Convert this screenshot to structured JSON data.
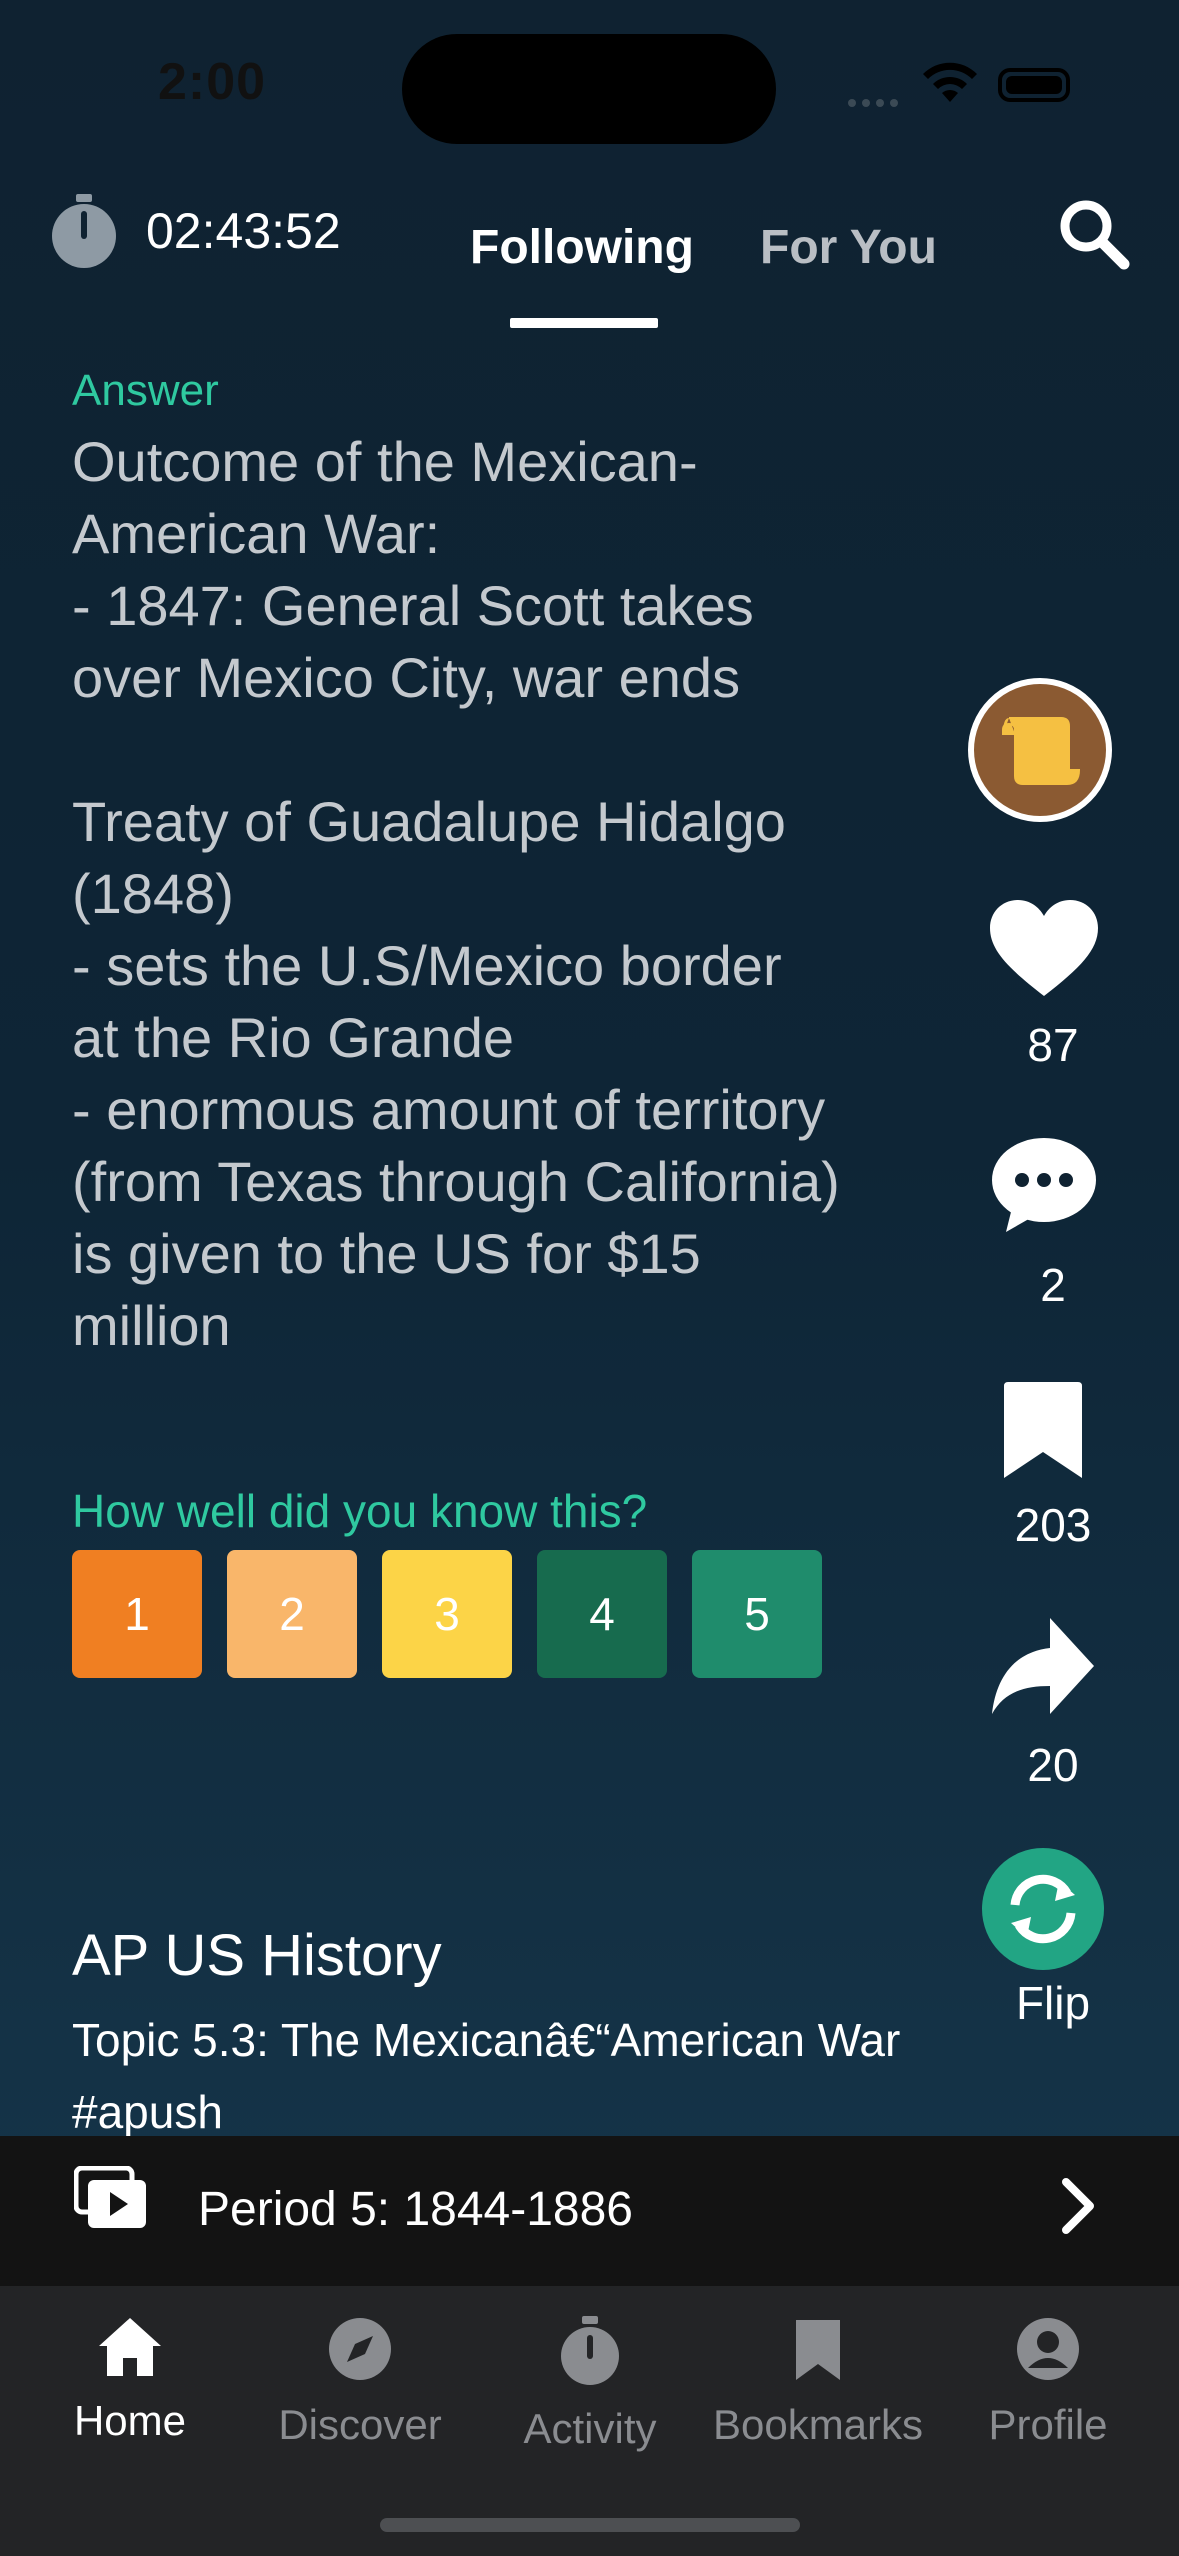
{
  "status_bar": {
    "time": "2:00"
  },
  "header": {
    "timer": "02:43:52",
    "tabs": [
      {
        "label": "Following"
      },
      {
        "label": "For You"
      }
    ]
  },
  "card": {
    "answer_label": "Answer",
    "answer_text": "Outcome of the Mexican-\nAmerican War:\n- 1847: General Scott takes\nover Mexico City, war ends\n\nTreaty of Guadalupe Hidalgo\n(1848)\n- sets the U.S/Mexico border\nat the Rio Grande\n- enormous amount of territory\n(from Texas through California)\nis given to the US for $15\nmillion",
    "rating_prompt": "How well did you know this?",
    "ratings": [
      {
        "label": "1",
        "color": "#f07f22"
      },
      {
        "label": "2",
        "color": "#f9b66a"
      },
      {
        "label": "3",
        "color": "#fcd447"
      },
      {
        "label": "4",
        "color": "#176b4e"
      },
      {
        "label": "5",
        "color": "#1f8c6c"
      }
    ],
    "course": "AP US History",
    "topic": "Topic 5.3: The Mexicanâ€“American War #apush"
  },
  "actions": {
    "likes": "87",
    "comments": "2",
    "bookmarks": "203",
    "shares": "20",
    "flip": "Flip"
  },
  "playlist": {
    "title": "Period 5: 1844-1886"
  },
  "tabbar": {
    "items": [
      {
        "label": "Home",
        "icon": "home-icon"
      },
      {
        "label": "Discover",
        "icon": "compass-icon"
      },
      {
        "label": "Activity",
        "icon": "stopwatch-icon"
      },
      {
        "label": "Bookmarks",
        "icon": "bookmark-icon"
      },
      {
        "label": "Profile",
        "icon": "profile-icon"
      }
    ]
  }
}
